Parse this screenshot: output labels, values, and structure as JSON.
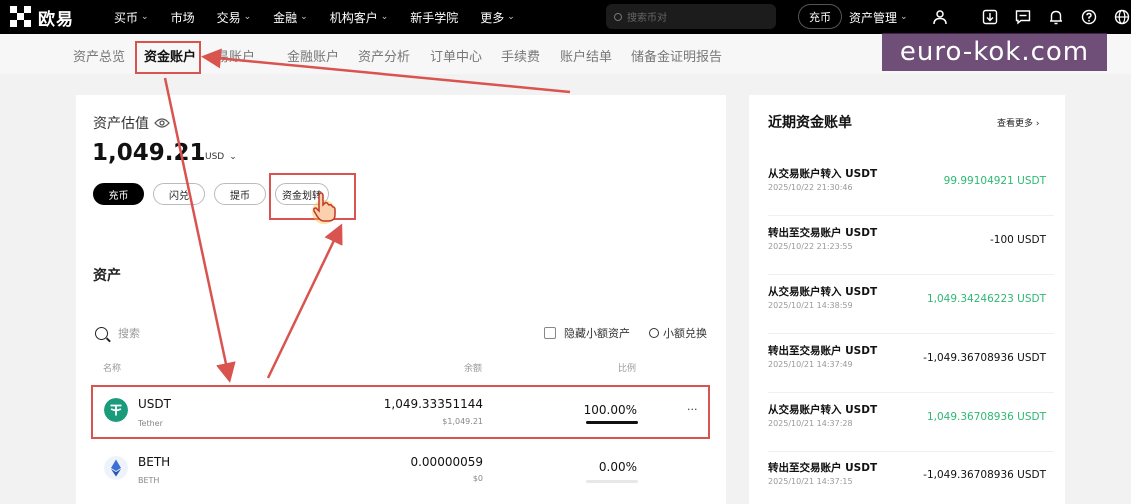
{
  "colors": {
    "topbar": "#000000",
    "accent_green": "#2eb872",
    "annotation_red": "#d9534f",
    "usdt_green": "#1a9b7b",
    "watermark": "#50285a"
  },
  "topbar": {
    "logo_text": "欧易",
    "nav": [
      "买币",
      "市场",
      "交易",
      "金融",
      "机构客户",
      "新手学院",
      "更多"
    ],
    "search_placeholder": "搜索币对",
    "deposit_label": "充币",
    "asset_mgmt_label": "资产管理",
    "icons": [
      "user-icon",
      "download-icon",
      "message-icon",
      "bell-icon",
      "help-icon",
      "globe-icon"
    ]
  },
  "subnav": {
    "items": [
      "资产总览",
      "资金账户",
      "易账户",
      "金融账户",
      "资产分析",
      "订单中心",
      "手续费",
      "账户结单",
      "储备金证明报告"
    ],
    "active_index": 1
  },
  "watermark": "euro-kok.com",
  "valuation": {
    "title": "资产估值",
    "amount": "1,049.21",
    "currency": "USD",
    "buttons": {
      "deposit": "充币",
      "swap": "闪兑",
      "withdraw": "提币",
      "transfer": "资金划转"
    }
  },
  "assets": {
    "title": "资产",
    "search_placeholder": "搜索",
    "hide_small_label": "隐藏小额资产",
    "convert_label": "小额兑换",
    "columns": {
      "name": "名称",
      "balance": "余额",
      "ratio": "比例"
    },
    "rows": [
      {
        "symbol": "USDT",
        "name": "Tether",
        "balance": "1,049.33351144",
        "usd_value": "$1,049.21",
        "ratio": "100.00%",
        "ratio_value": 1.0,
        "more": "···"
      },
      {
        "symbol": "BETH",
        "name": "BETH",
        "balance": "0.00000059",
        "usd_value": "$0",
        "ratio": "0.00%",
        "ratio_value": 0.0,
        "more": ""
      }
    ]
  },
  "recent": {
    "title": "近期资金账单",
    "more_label": "查看更多 ›",
    "records": [
      {
        "title": "从交易账户转入 USDT",
        "time": "2025/10/22 21:30:46",
        "amount": "99.99104921 USDT",
        "positive": true
      },
      {
        "title": "转出至交易账户 USDT",
        "time": "2025/10/22 21:23:55",
        "amount": "-100 USDT",
        "positive": false
      },
      {
        "title": "从交易账户转入 USDT",
        "time": "2025/10/21 14:38:59",
        "amount": "1,049.34246223 USDT",
        "positive": true
      },
      {
        "title": "转出至交易账户 USDT",
        "time": "2025/10/21 14:37:49",
        "amount": "-1,049.36708936 USDT",
        "positive": false
      },
      {
        "title": "从交易账户转入 USDT",
        "time": "2025/10/21 14:37:28",
        "amount": "1,049.36708936 USDT",
        "positive": true
      },
      {
        "title": "转出至交易账户 USDT",
        "time": "2025/10/21 14:37:15",
        "amount": "-1,049.36708936 USDT",
        "positive": false
      }
    ]
  }
}
